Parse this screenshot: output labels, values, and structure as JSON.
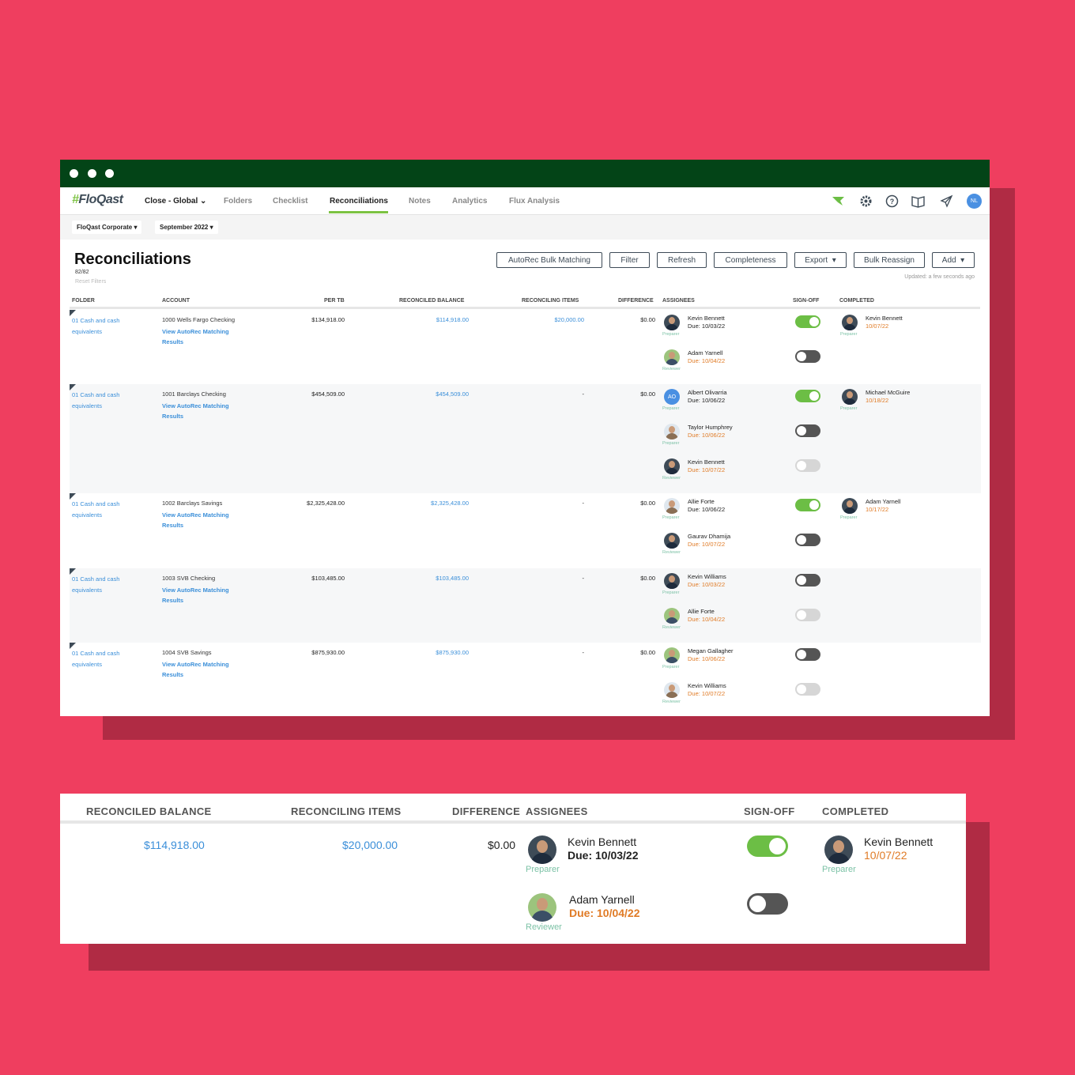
{
  "nav": {
    "logo": "FloQast",
    "items": [
      "Close - Global",
      "Folders",
      "Checklist",
      "Reconciliations",
      "Notes",
      "Analytics",
      "Flux Analysis"
    ],
    "active": "Reconciliations",
    "user_initials": "NL"
  },
  "filters": {
    "entity": "FloQast Corporate",
    "period": "September 2022"
  },
  "page": {
    "title": "Reconciliations",
    "count": "82/82",
    "reset": "Reset Filters",
    "updated": "Updated: a few seconds ago",
    "buttons": [
      "AutoRec Bulk Matching",
      "Filter",
      "Refresh",
      "Completeness",
      "Export",
      "Bulk Reassign",
      "Add"
    ]
  },
  "table": {
    "headers": [
      "FOLDER",
      "ACCOUNT",
      "PER TB",
      "RECONCILED BALANCE",
      "RECONCILING ITEMS",
      "DIFFERENCE",
      "ASSIGNEES",
      "SIGN-OFF",
      "COMPLETED"
    ],
    "link1": "View AutoRec Matching",
    "link2": "Results",
    "folder1": "01 Cash and cash",
    "folder2": "equivalents",
    "rows": [
      {
        "account": "1000 Wells Fargo Checking",
        "per_tb": "$134,918.00",
        "reconciled": "$114,918.00",
        "items": "$20,000.00",
        "difference": "$0.00",
        "assignees": [
          {
            "name": "Kevin Bennett",
            "due": "Due: 10/03/22",
            "due_color": "dark",
            "role": "Preparer",
            "signoff": "on"
          },
          {
            "name": "Adam Yarnell",
            "due": "Due: 10/04/22",
            "due_color": "orange",
            "role": "Reviewer",
            "signoff": "off"
          }
        ],
        "completed": {
          "name": "Kevin Bennett",
          "date": "10/07/22",
          "role": "Preparer"
        }
      },
      {
        "account": "1001 Barclays Checking",
        "per_tb": "$454,509.00",
        "reconciled": "$454,509.00",
        "items": "-",
        "difference": "$0.00",
        "assignees": [
          {
            "name": "Albert Olivarria",
            "due": "Due: 10/06/22",
            "due_color": "dark",
            "role": "Preparer",
            "signoff": "on",
            "initials": "AO"
          },
          {
            "name": "Taylor Humphrey",
            "due": "Due: 10/06/22",
            "due_color": "orange",
            "role": "Preparer",
            "signoff": "off"
          },
          {
            "name": "Kevin Bennett",
            "due": "Due: 10/07/22",
            "due_color": "orange",
            "role": "Reviewer",
            "signoff": "disabled"
          }
        ],
        "completed": {
          "name": "Michael McGuire",
          "date": "10/18/22",
          "role": "Preparer"
        }
      },
      {
        "account": "1002 Barclays Savings",
        "per_tb": "$2,325,428.00",
        "reconciled": "$2,325,428.00",
        "items": "-",
        "difference": "$0.00",
        "assignees": [
          {
            "name": "Allie Forte",
            "due": "Due: 10/06/22",
            "due_color": "dark",
            "role": "Preparer",
            "signoff": "on"
          },
          {
            "name": "Gaurav Dhamija",
            "due": "Due: 10/07/22",
            "due_color": "orange",
            "role": "Reviewer",
            "signoff": "off"
          }
        ],
        "completed": {
          "name": "Adam Yarnell",
          "date": "10/17/22",
          "role": "Preparer"
        }
      },
      {
        "account": "1003 SVB Checking",
        "per_tb": "$103,485.00",
        "reconciled": "$103,485.00",
        "items": "-",
        "difference": "$0.00",
        "assignees": [
          {
            "name": "Kevin Williams",
            "due": "Due: 10/03/22",
            "due_color": "orange",
            "role": "Preparer",
            "signoff": "off"
          },
          {
            "name": "Allie Forte",
            "due": "Due: 10/04/22",
            "due_color": "orange",
            "role": "Reviewer",
            "signoff": "disabled"
          }
        ],
        "completed": null
      },
      {
        "account": "1004 SVB Savings",
        "per_tb": "$875,930.00",
        "reconciled": "$875,930.00",
        "items": "-",
        "difference": "$0.00",
        "assignees": [
          {
            "name": "Megan Gallagher",
            "due": "Due: 10/06/22",
            "due_color": "orange",
            "role": "Preparer",
            "signoff": "off"
          },
          {
            "name": "Kevin Williams",
            "due": "Due: 10/07/22",
            "due_color": "orange",
            "role": "Reviewer",
            "signoff": "disabled"
          }
        ],
        "completed": null
      }
    ]
  },
  "zoom": {
    "headers": [
      "RECONCILED BALANCE",
      "RECONCILING ITEMS",
      "DIFFERENCE",
      "ASSIGNEES",
      "SIGN-OFF",
      "COMPLETED"
    ],
    "reconciled": "$114,918.00",
    "items": "$20,000.00",
    "difference": "$0.00",
    "assignee1": {
      "name": "Kevin Bennett",
      "due": "Due: 10/03/22",
      "role": "Preparer"
    },
    "assignee2": {
      "name": "Adam Yarnell",
      "due": "Due: 10/04/22",
      "role": "Reviewer"
    },
    "completed": {
      "name": "Kevin Bennett",
      "date": "10/07/22",
      "role": "Preparer"
    }
  },
  "colors": {
    "background": "#ef3e5f",
    "titlebar": "#034417",
    "accent_green": "#6cbe45",
    "link_blue": "#3b8fd9",
    "due_orange": "#e07b26"
  }
}
